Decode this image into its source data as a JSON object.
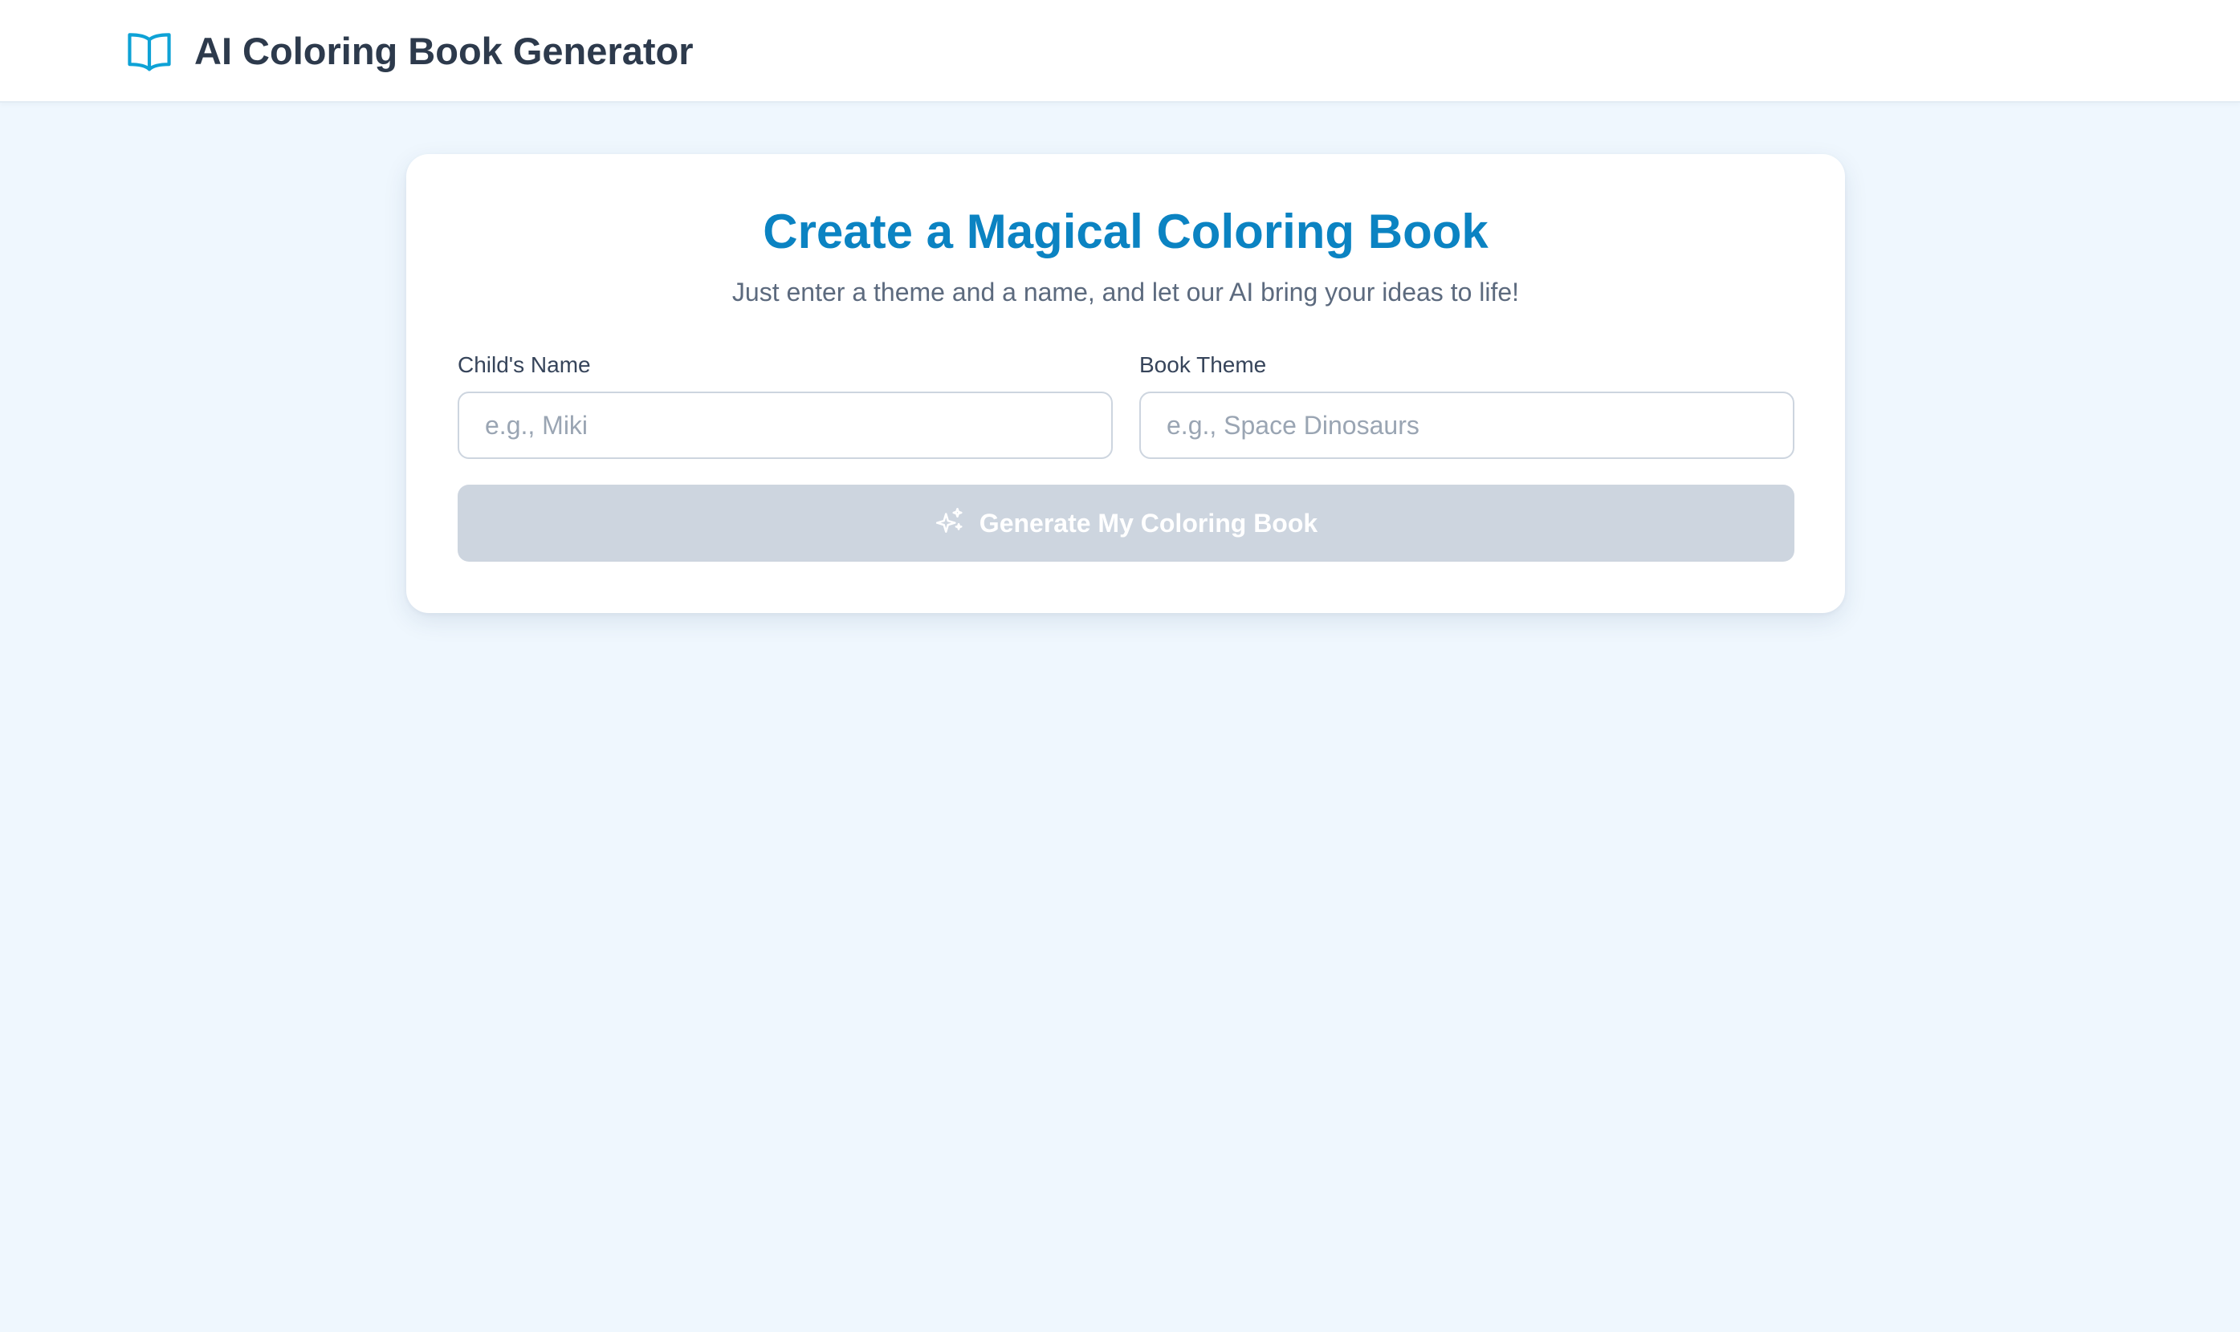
{
  "header": {
    "icon": "open-book-icon",
    "title": "AI Coloring Book Generator"
  },
  "form": {
    "title": "Create a Magical Coloring Book",
    "subtitle": "Just enter a theme and a name, and let our AI bring your ideas to life!",
    "child_name": {
      "label": "Child's Name",
      "value": "",
      "placeholder": "e.g., Miki"
    },
    "book_theme": {
      "label": "Book Theme",
      "value": "",
      "placeholder": "e.g., Space Dinosaurs"
    },
    "generate_button": {
      "icon": "sparkles-icon",
      "label": "Generate My Coloring Book",
      "state": "disabled"
    }
  },
  "colors": {
    "accent": "#0b83c2",
    "page_background": "#eff7fe",
    "button_disabled": "#cdd5df"
  }
}
